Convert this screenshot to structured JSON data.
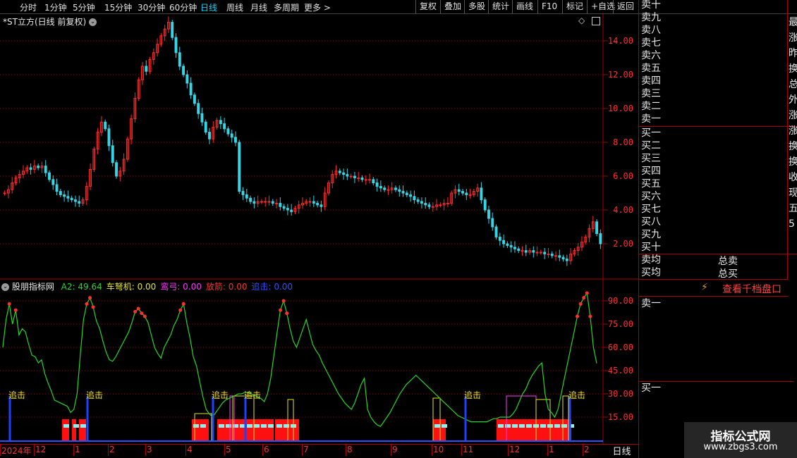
{
  "toolbar": {
    "periods": [
      "分时",
      "1分钟",
      "5分钟",
      "15分钟",
      "30分钟",
      "60分钟",
      "日线",
      "周线",
      "月线",
      "多周期",
      "更多 >"
    ],
    "active_period": "日线",
    "right_buttons": [
      "复权",
      "叠加",
      "多股",
      "统计",
      "画线",
      "F10",
      "标记",
      "+自选",
      "返回"
    ]
  },
  "main": {
    "title": "*ST立方(日线 前复权)",
    "y_ticks": [
      "14.00",
      "12.00",
      "10.00",
      "8.00",
      "6.00",
      "4.00",
      "2.00"
    ]
  },
  "indicator": {
    "name": "股朋指标网",
    "values": [
      {
        "label": "A2: 49.64",
        "color": "#27d827"
      },
      {
        "label": "车弩机: 0.00",
        "color": "#e6e62a"
      },
      {
        "label": "鸾弓: 0.00",
        "color": "#ff38ff"
      },
      {
        "label": "放箭: 0.00",
        "color": "#ff3030"
      },
      {
        "label": "追击: 0.00",
        "color": "#3050ff"
      }
    ],
    "y_ticks": [
      "90.00",
      "75.00",
      "60.00",
      "45.00",
      "30.00",
      "15.00"
    ],
    "signal_label": "追击",
    "bar_text": "箭箭箭"
  },
  "x_axis": {
    "labels": [
      "2024年",
      "12",
      "1",
      "2",
      "3",
      "4",
      "5",
      "6",
      "7",
      "8",
      "9",
      "10",
      "11",
      "12",
      "1",
      "2"
    ],
    "period_button": "日线"
  },
  "order_book": {
    "sell_levels": [
      "卖十",
      "卖九",
      "卖八",
      "卖七",
      "卖六",
      "卖五",
      "卖四",
      "卖三",
      "卖二",
      "卖一"
    ],
    "buy_levels": [
      "买一",
      "买二",
      "买三",
      "买四",
      "买五",
      "买六",
      "买七",
      "买八",
      "买九",
      "买十"
    ],
    "avg_sell": "卖均",
    "avg_buy": "买均",
    "total_sell": "总卖",
    "total_buy": "总买",
    "depth_link": "查看千档盘口",
    "sell_one": "卖一",
    "buy_one": "买一",
    "edge_chars": [
      "最",
      "涨",
      "昨",
      "换",
      "总",
      "外",
      "涨",
      "涨",
      "换",
      "换",
      "收",
      "现",
      "五",
      "5"
    ]
  },
  "watermark": {
    "title": "指标公式网",
    "url": "www.zbgs3.com"
  },
  "colors": {
    "up": "#ff2a2a",
    "down": "#35d6e6",
    "axis_red": "#ff3030",
    "grid": "#7a1010",
    "a2_line": "#27d827"
  },
  "chart_data": [
    {
      "type": "candlestick",
      "title": "*ST立方(日线 前复权)",
      "ylim": [
        0.5,
        15.5
      ],
      "x_range": [
        "2024-11",
        "2026-02"
      ],
      "close": [
        5,
        5.2,
        5.6,
        5.9,
        6.1,
        6.3,
        6.5,
        6.4,
        6.6,
        6.5,
        6.6,
        6.2,
        5.8,
        5.5,
        5.1,
        4.9,
        4.8,
        4.7,
        4.6,
        4.5,
        4.4,
        4.6,
        5.4,
        6.4,
        7.6,
        8.6,
        9.2,
        8.8,
        7.8,
        6.8,
        6,
        6.3,
        7,
        8.2,
        9.4,
        10.6,
        11.7,
        12.5,
        12.2,
        12.9,
        13.3,
        13.8,
        14.3,
        14.7,
        15.1,
        14.2,
        13.3,
        12.5,
        12,
        11.5,
        10.8,
        10.3,
        9.7,
        9.2,
        8.6,
        8.2,
        8.9,
        9.3,
        9.1,
        8.8,
        8.5,
        8.3,
        8,
        5.1,
        4.9,
        4.7,
        4.5,
        4.4,
        4.5,
        4.5,
        4.5,
        4.5,
        4.4,
        4.4,
        4.2,
        4.1,
        4,
        3.9,
        4.1,
        4.3,
        4.4,
        4.5,
        4.5,
        4.4,
        4.3,
        4.2,
        5,
        5.6,
        6.1,
        6.3,
        6.2,
        6.1,
        6,
        6,
        5.9,
        5.9,
        5.8,
        5.8,
        5.8,
        5.6,
        5.4,
        5.3,
        5.2,
        5.2,
        5.3,
        5.2,
        5.1,
        5,
        4.9,
        4.8,
        4.6,
        4.5,
        4.4,
        4.3,
        4.2,
        4.2,
        4.3,
        4.3,
        4.4,
        4.4,
        5,
        5.2,
        5.1,
        5,
        4.9,
        4.9,
        5.1,
        5.3,
        4.6,
        4,
        3.5,
        3,
        2.4,
        2.2,
        2,
        1.9,
        1.8,
        1.7,
        1.6,
        1.6,
        1.5,
        1.6,
        1.5,
        1.5,
        1.5,
        1.4,
        1.4,
        1.3,
        1.3,
        1.2,
        1.1,
        1,
        1.4,
        1.6,
        1.8,
        2.1,
        2.4,
        2.9,
        3.3,
        2.6,
        2
      ]
    },
    {
      "type": "line",
      "series": [
        {
          "name": "A2",
          "values": [
            60,
            78,
            88,
            75,
            84,
            68,
            72,
            70,
            62,
            55,
            54,
            50,
            52,
            43,
            37,
            32,
            26,
            25,
            24,
            23,
            22,
            18,
            20,
            30,
            55,
            78,
            88,
            92,
            86,
            77,
            72,
            64,
            57,
            52,
            51,
            54,
            58,
            62,
            66,
            70,
            76,
            83,
            85,
            82,
            80,
            76,
            68,
            60,
            56,
            53,
            60,
            64,
            68,
            74,
            78,
            84,
            88,
            76,
            66,
            54,
            48,
            38,
            28,
            20,
            17,
            15,
            18,
            21,
            24,
            26,
            27,
            28,
            29,
            30,
            30,
            31,
            31,
            30,
            29,
            28,
            27,
            25,
            30,
            40,
            55,
            70,
            84,
            90,
            82,
            72,
            64,
            60,
            66,
            72,
            78,
            70,
            62,
            58,
            55,
            50,
            46,
            42,
            38,
            34,
            30,
            27,
            24,
            22,
            20,
            24,
            30,
            36,
            40,
            20,
            15,
            12,
            10,
            9,
            12,
            15,
            18,
            22,
            26,
            30,
            33,
            36,
            38,
            40,
            42,
            40,
            38,
            36,
            34,
            32,
            30,
            28,
            26,
            24,
            22,
            20,
            18,
            16,
            15,
            14,
            13,
            12,
            12,
            12,
            12,
            12,
            12,
            13,
            14,
            14,
            15,
            15,
            15,
            15,
            17,
            20,
            25,
            30,
            33,
            38,
            42,
            45,
            48,
            50,
            30,
            20,
            18,
            15,
            20,
            30,
            40,
            50,
            60,
            70,
            80,
            88,
            92,
            95,
            80,
            60,
            49.64
          ]
        }
      ],
      "ylim": [
        0,
        100
      ]
    }
  ]
}
